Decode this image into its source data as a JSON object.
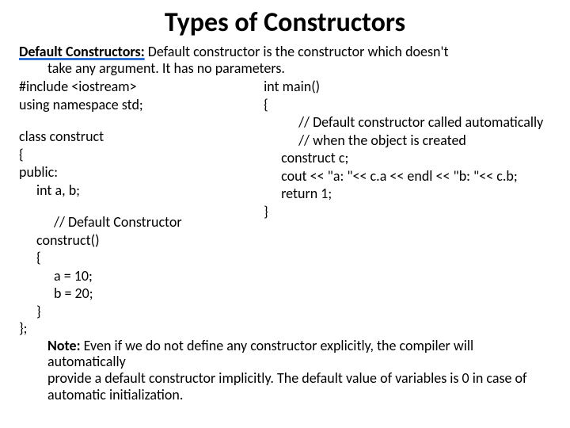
{
  "title": "Types of Constructors",
  "intro": {
    "heading": "Default Constructors:",
    "text1": " Default constructor is the constructor which doesn't",
    "text2": "take any argument. It has no parameters."
  },
  "left": {
    "l1": "#include <iostream>",
    "l2": "using namespace std;",
    "l3": "class construct",
    "l4": "{",
    "l5": "public:",
    "l6": "int a, b;",
    "l7": "// Default Constructor",
    "l8": "construct()",
    "l9": "{",
    "l10": "a = 10;",
    "l11": "b = 20;",
    "l12": "}"
  },
  "right": {
    "r1": "int main()",
    "r2": "{",
    "r3": "// Default constructor called automatically",
    "r4": "// when the object is created",
    "r5": "construct c;",
    "r6": "cout << \"a: \"<< c.a << endl << \"b: \"<< c.b;",
    "r7": "return 1;",
    "r8": "}"
  },
  "closing": "};",
  "note": {
    "label": "Note:",
    "n1": " Even if we do not define any constructor explicitly, the compiler will automatically",
    "n2": "provide a default constructor implicitly. The default value of variables is 0 in case of",
    "n3": "automatic initialization."
  }
}
